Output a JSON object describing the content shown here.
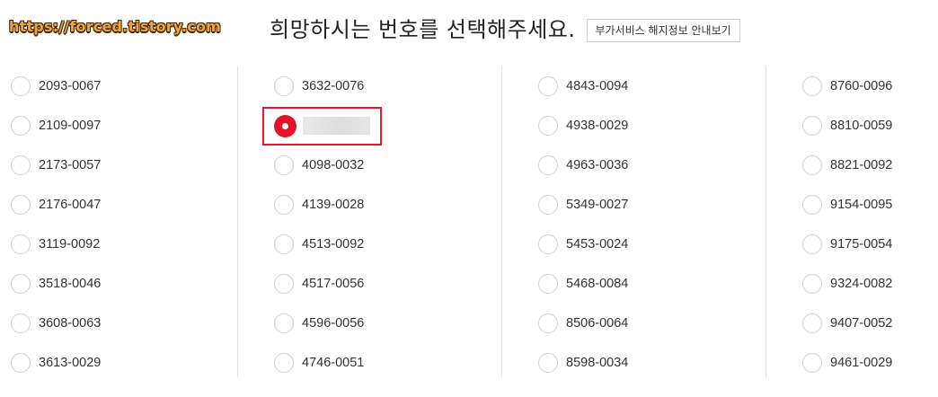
{
  "watermark": "https://forced.tistory.com",
  "header": {
    "title": "희망하시는 번호를 선택해주세요.",
    "info_button": "부가서비스 해지정보 안내보기"
  },
  "columns": [
    [
      "2093-0067",
      "2109-0097",
      "2173-0057",
      "2176-0047",
      "3119-0092",
      "3518-0046",
      "3608-0063",
      "3613-0029"
    ],
    [
      "3632-0076",
      "",
      "4098-0032",
      "4139-0028",
      "4513-0092",
      "4517-0056",
      "4596-0056",
      "4746-0051"
    ],
    [
      "4843-0094",
      "4938-0029",
      "4963-0036",
      "5349-0027",
      "5453-0024",
      "5468-0084",
      "8506-0064",
      "8598-0034"
    ],
    [
      "8760-0096",
      "8810-0059",
      "8821-0092",
      "9154-0095",
      "9175-0054",
      "9324-0082",
      "9407-0052",
      "9461-0029"
    ]
  ],
  "selected": {
    "column": 1,
    "row": 1,
    "value_masked": true
  },
  "colors": {
    "accent": "#e5122c",
    "highlight_border": "#e01a2b"
  }
}
